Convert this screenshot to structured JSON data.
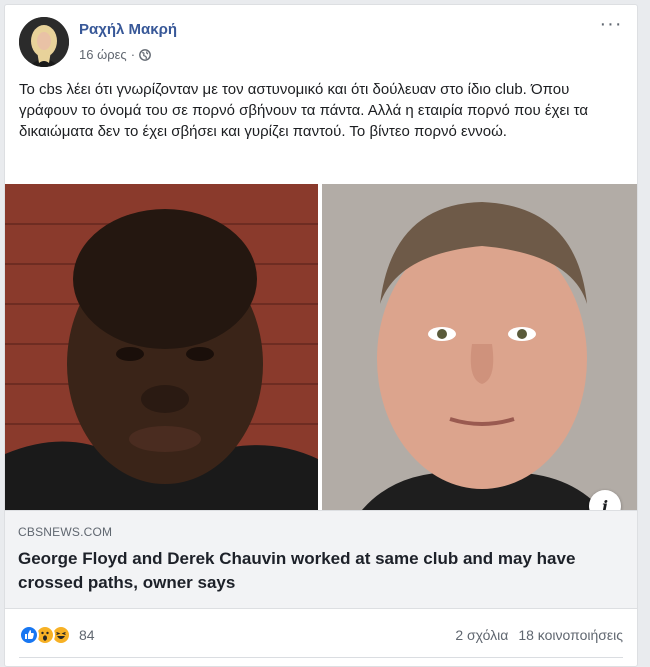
{
  "post": {
    "author": "Ραχήλ Μακρή",
    "time": "16 ώρες",
    "separator": "·",
    "privacy_icon": "globe-icon",
    "more_icon": "more-options-icon",
    "more_label": "···",
    "text": "Το cbs λέει ότι γνωρίζονταν με τον αστυνομικό και ότι δούλευαν στο ίδιο club. Όπου γράφουν το όνομά του σε πορνό σβήνουν τα πάντα. Αλλά η εταιρία πορνό που έχει τα δικαιώματα δεν το έχει σβήσει και γυρίζει παντού. Το βίντεο πορνό εννοώ."
  },
  "link": {
    "domain": "CBSNEWS.COM",
    "title": "George Floyd and Derek Chauvin worked at same club and may have crossed paths, owner says",
    "info_label": "i"
  },
  "footer": {
    "reaction_icons": [
      "like-icon",
      "wow-icon",
      "haha-icon"
    ],
    "reaction_count": "84",
    "comments": "2 σχόλια",
    "shares": "18 κοινοποιήσεις"
  },
  "colors": {
    "author": "#385898",
    "like": "#1877f2",
    "emoji": "#f7b125",
    "link_bg": "#f2f3f5"
  }
}
